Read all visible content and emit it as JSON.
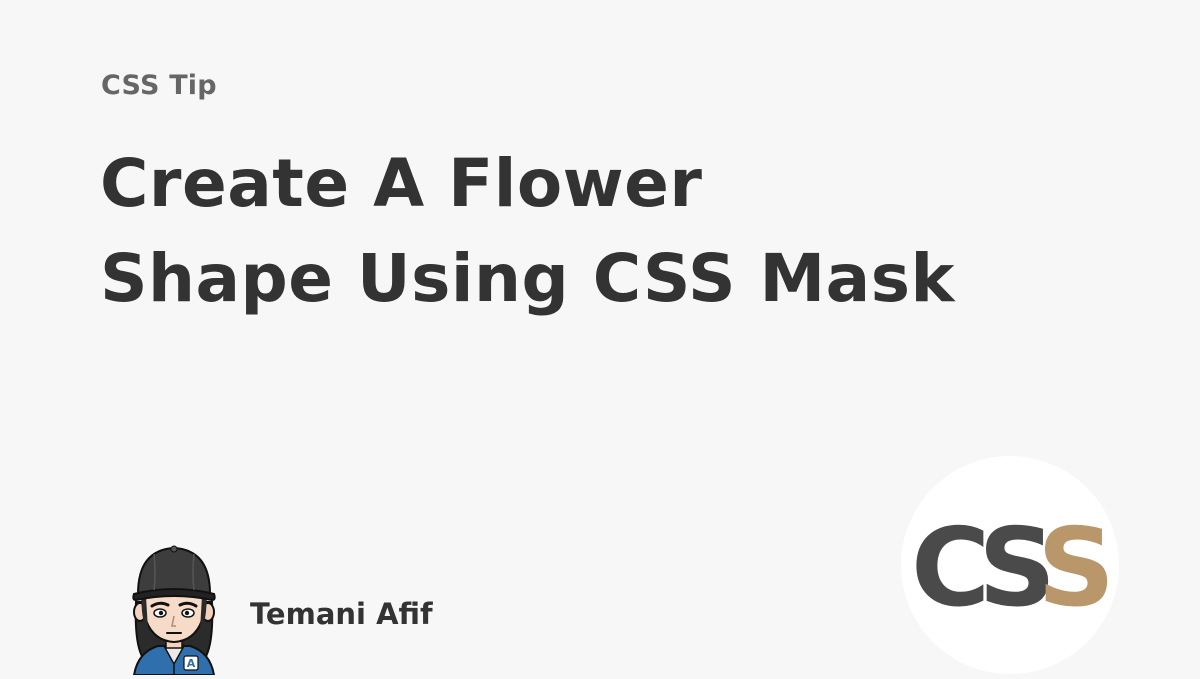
{
  "category": "CSS Tip",
  "title": {
    "line1": "Create A Flower",
    "line2": "Shape Using CSS Mask"
  },
  "author": {
    "name": "Temani Afif",
    "avatar_badge_letter": "A"
  },
  "logo": {
    "text": "CSS",
    "colors": {
      "dark": "#4a4a4a",
      "accent": "#b9976b",
      "background": "#ffffff"
    }
  },
  "colors": {
    "page_background": "#f7f7f7",
    "title_text": "#333333",
    "category_text": "#666666"
  }
}
